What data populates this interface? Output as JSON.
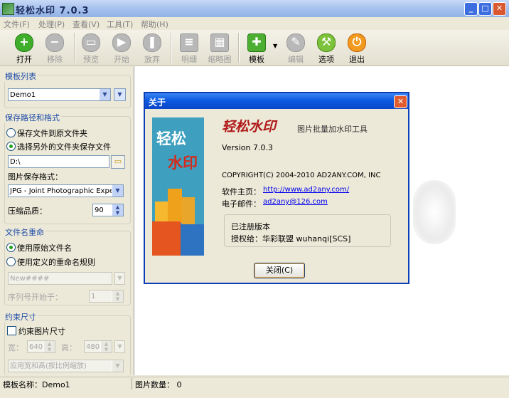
{
  "app": {
    "title": "轻松水印 7.0.3"
  },
  "menu": [
    "文件(F)",
    "处理(P)",
    "查看(V)",
    "工具(T)",
    "帮助(H)"
  ],
  "toolbar": {
    "open": "打开",
    "remove": "移除",
    "preview": "预览",
    "start": "开始",
    "abort": "放弃",
    "detail": "明细",
    "thumb": "缩略图",
    "template": "模板",
    "edit": "编辑",
    "options": "选项",
    "exit": "退出"
  },
  "templates": {
    "title": "模板列表",
    "selected": "Demo1"
  },
  "save": {
    "title": "保存路径和格式",
    "opt_original": "保存文件到原文件夹",
    "opt_other": "选择另外的文件夹保存文件",
    "path": "D:\\",
    "format_label": "图片保存格式：",
    "format_value": "JPG - Joint Photographic Experts Gr",
    "quality_label": "压缩品质：",
    "quality_value": "90"
  },
  "rename": {
    "title": "文件名重命",
    "opt_original": "使用原始文件名",
    "opt_custom": "使用定义的重命名规则",
    "pattern": "New####",
    "seq_label": "序列号开始于：",
    "seq_value": "1"
  },
  "constraint": {
    "title": "约束尺寸",
    "checkbox": "约束图片尺寸",
    "width_label": "宽：",
    "width_value": "640",
    "height_label": "高：",
    "height_value": "480",
    "mode": "应用宽和高(按比例缩放)"
  },
  "status": {
    "template": "模板名称：Demo1",
    "count": "图片数量： 0"
  },
  "about": {
    "title": "关于",
    "logo_line1": "轻松",
    "logo_line2": "水印",
    "brand": "轻松水印",
    "tagline": "图片批量加水印工具",
    "version": "Version  7.0.3",
    "copyright": "COPYRIGHT(C) 2004-2010 AD2ANY.COM, INC",
    "home_label": "软件主页：",
    "home_url": "http://www.ad2any.com/",
    "mail_label": "电子邮件：",
    "mail_addr": "ad2any@126.com",
    "registered": "已注册版本",
    "licensee": "授权给：华彩联盟 wuhanqi[SCS]",
    "close_btn": "关闭(C)"
  },
  "colors": {
    "titlebar": "#0a46c8",
    "accent": "#1f4ca8",
    "link": "#0000ee"
  }
}
